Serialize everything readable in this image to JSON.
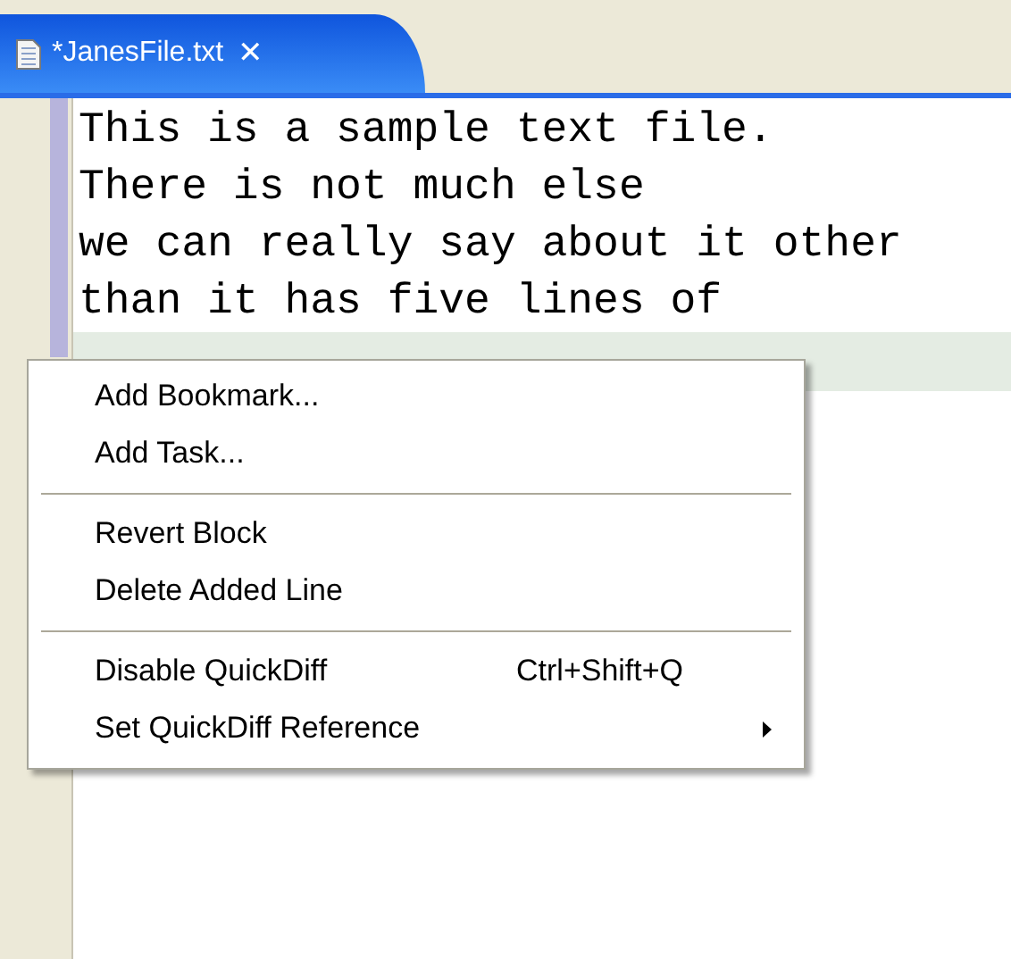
{
  "tab": {
    "title": "*JanesFile.txt",
    "close": "✕",
    "selected": true
  },
  "editor": {
    "lines": [
      "This is a sample text file.",
      "There is not much else",
      "we can really say about it other",
      "than it has five lines of"
    ],
    "current_line_highlight": true
  },
  "context_menu": {
    "items": [
      {
        "kind": "item",
        "label": "Add Bookmark..."
      },
      {
        "kind": "item",
        "label": "Add Task..."
      },
      {
        "kind": "separator"
      },
      {
        "kind": "item",
        "label": "Revert Block"
      },
      {
        "kind": "item",
        "label": "Delete Added Line"
      },
      {
        "kind": "separator"
      },
      {
        "kind": "item",
        "label": "Disable QuickDiff",
        "shortcut": "Ctrl+Shift+Q"
      },
      {
        "kind": "item",
        "label": "Set QuickDiff Reference",
        "submenu": true
      }
    ]
  }
}
